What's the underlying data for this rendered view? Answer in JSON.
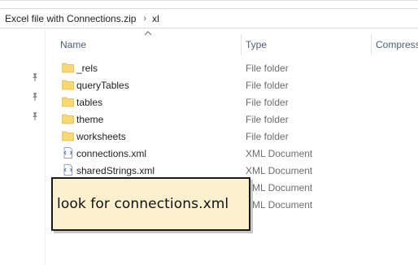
{
  "breadcrumb": {
    "items": [
      "Excel file with Connections.zip",
      "xl"
    ]
  },
  "columns": {
    "name": "Name",
    "type": "Type",
    "compressed": "Compress"
  },
  "files": [
    {
      "name": "_rels",
      "type": "File folder",
      "icon": "folder-icon"
    },
    {
      "name": "queryTables",
      "type": "File folder",
      "icon": "folder-icon"
    },
    {
      "name": "tables",
      "type": "File folder",
      "icon": "folder-icon"
    },
    {
      "name": "theme",
      "type": "File folder",
      "icon": "folder-icon"
    },
    {
      "name": "worksheets",
      "type": "File folder",
      "icon": "folder-icon"
    },
    {
      "name": "connections.xml",
      "type": "XML Document",
      "icon": "xml-file-icon"
    },
    {
      "name": "sharedStrings.xml",
      "type": "XML Document",
      "icon": "xml-file-icon"
    },
    {
      "name": "",
      "type": "XML Document",
      "icon": "xml-file-icon"
    },
    {
      "name": "",
      "type": "XML Document",
      "icon": "xml-file-icon"
    }
  ],
  "annotation": {
    "text": "look for connections.xml"
  },
  "colors": {
    "folder": "#f8d775",
    "header_text": "#4c607a",
    "callout_bg": "#fcf0cf"
  }
}
